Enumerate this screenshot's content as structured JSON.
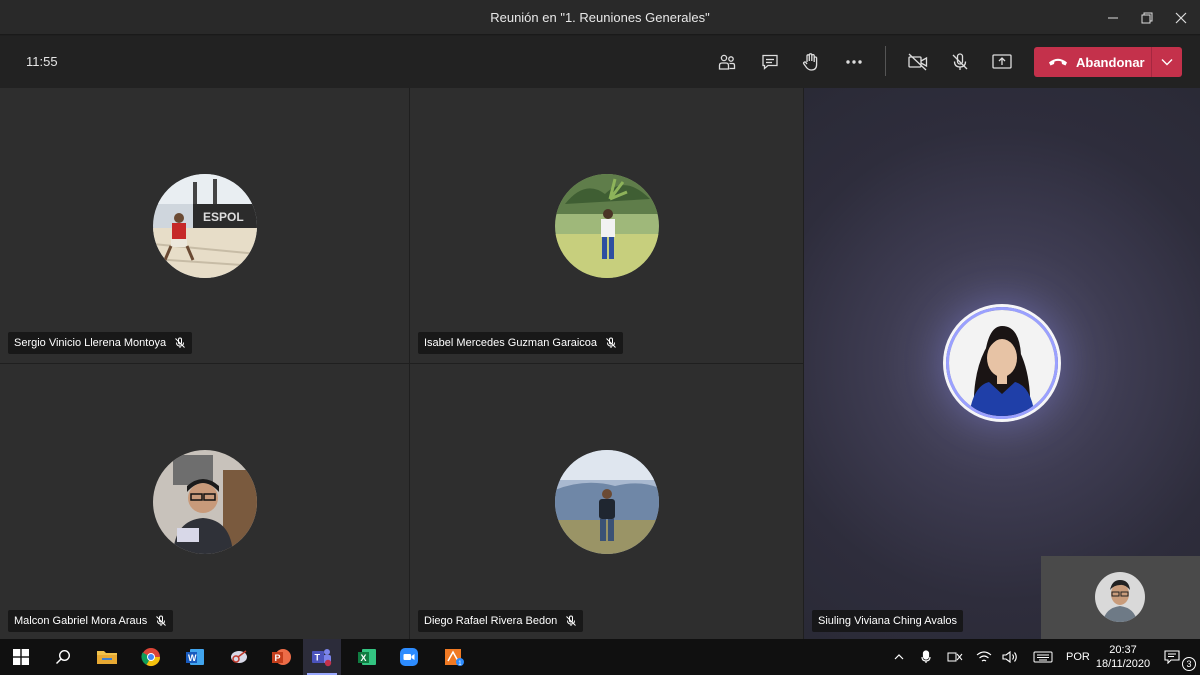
{
  "window": {
    "title": "Reunión en \"1. Reuniones Generales\""
  },
  "toolbar": {
    "timer": "11:55",
    "leave_label": "Abandonar",
    "colors": {
      "leave_button": "#c4314b",
      "toolbar_bg": "#222222"
    },
    "icons": [
      "participants-icon",
      "chat-icon",
      "raise-hand-icon",
      "more-options-icon",
      "camera-off-icon",
      "mic-off-icon",
      "share-screen-icon",
      "phone-hangup-icon",
      "chevron-down-icon"
    ]
  },
  "participants": [
    {
      "name": "Sergio Vinicio Llerena Montoya",
      "muted": true
    },
    {
      "name": "Isabel Mercedes Guzman Garaicoa",
      "muted": true
    },
    {
      "name": "Malcon Gabriel Mora Araus",
      "muted": true
    },
    {
      "name": "Diego Rafael Rivera Bedon",
      "muted": true
    },
    {
      "name": "Siuling Viviana Ching Avalos",
      "muted": false,
      "speaking": true
    }
  ],
  "taskbar": {
    "apps": [
      "windows-start-icon",
      "search-icon",
      "file-explorer-icon",
      "chrome-icon",
      "word-icon",
      "snipping-tool-icon",
      "powerpoint-icon",
      "teams-icon",
      "excel-icon",
      "zoom-icon",
      "app-badge-icon"
    ],
    "active_app": "teams-icon",
    "language": "POR",
    "time": "20:37",
    "date": "18/11/2020",
    "notifications": "3"
  }
}
